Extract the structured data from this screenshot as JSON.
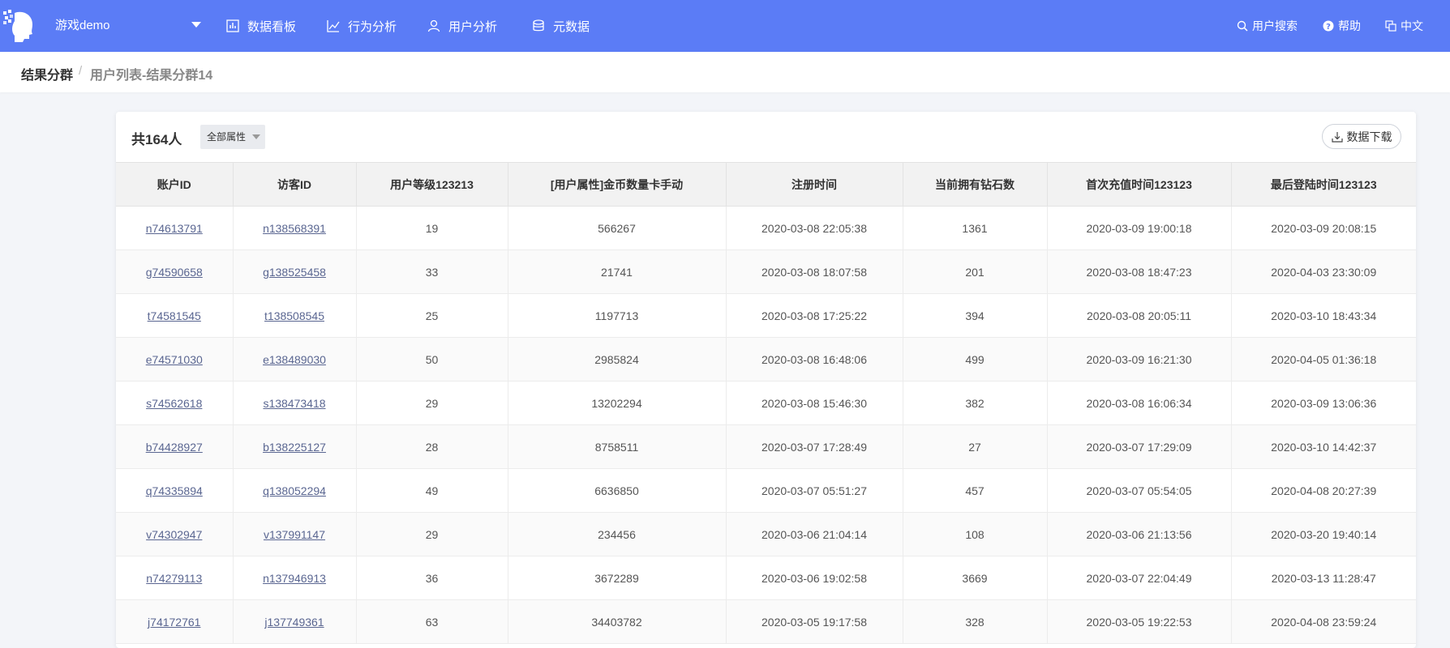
{
  "header": {
    "app_name": "游戏demo",
    "nav": [
      {
        "label": "数据看板",
        "icon": "bar-chart-icon"
      },
      {
        "label": "行为分析",
        "icon": "line-chart-icon"
      },
      {
        "label": "用户分析",
        "icon": "user-icon"
      },
      {
        "label": "元数据",
        "icon": "database-icon"
      }
    ],
    "right": [
      {
        "label": "用户搜索",
        "icon": "search-icon"
      },
      {
        "label": "帮助",
        "icon": "help-icon"
      },
      {
        "label": "中文",
        "icon": "language-icon"
      }
    ],
    "bg_color": "#5b7cf6"
  },
  "breadcrumb": {
    "root": "结果分群",
    "separator": "/",
    "current": "用户列表-结果分群14"
  },
  "card": {
    "total": "共164人",
    "filter": "全部属性",
    "download": "数据下载"
  },
  "table": {
    "columns": [
      "账户ID",
      "访客ID",
      "用户等级123213",
      "[用户属性]金币数量卡手动",
      "注册时间",
      "当前拥有钻石数",
      "首次充值时间123123",
      "最后登陆时间123123"
    ],
    "rows": [
      [
        "n74613791",
        "n138568391",
        "19",
        "566267",
        "2020-03-08 22:05:38",
        "1361",
        "2020-03-09 19:00:18",
        "2020-03-09 20:08:15"
      ],
      [
        "g74590658",
        "g138525458",
        "33",
        "21741",
        "2020-03-08 18:07:58",
        "201",
        "2020-03-08 18:47:23",
        "2020-04-03 23:30:09"
      ],
      [
        "t74581545",
        "t138508545",
        "25",
        "1197713",
        "2020-03-08 17:25:22",
        "394",
        "2020-03-08 20:05:11",
        "2020-03-10 18:43:34"
      ],
      [
        "e74571030",
        "e138489030",
        "50",
        "2985824",
        "2020-03-08 16:48:06",
        "499",
        "2020-03-09 16:21:30",
        "2020-04-05 01:36:18"
      ],
      [
        "s74562618",
        "s138473418",
        "29",
        "13202294",
        "2020-03-08 15:46:30",
        "382",
        "2020-03-08 16:06:34",
        "2020-03-09 13:06:36"
      ],
      [
        "b74428927",
        "b138225127",
        "28",
        "8758511",
        "2020-03-07 17:28:49",
        "27",
        "2020-03-07 17:29:09",
        "2020-03-10 14:42:37"
      ],
      [
        "q74335894",
        "q138052294",
        "49",
        "6636850",
        "2020-03-07 05:51:27",
        "457",
        "2020-03-07 05:54:05",
        "2020-04-08 20:27:39"
      ],
      [
        "v74302947",
        "v137991147",
        "29",
        "234456",
        "2020-03-06 21:04:14",
        "108",
        "2020-03-06 21:13:56",
        "2020-03-20 19:40:14"
      ],
      [
        "n74279113",
        "n137946913",
        "36",
        "3672289",
        "2020-03-06 19:02:58",
        "3669",
        "2020-03-07 22:04:49",
        "2020-03-13 11:28:47"
      ],
      [
        "j74172761",
        "j137749361",
        "63",
        "34403782",
        "2020-03-05 19:17:58",
        "328",
        "2020-03-05 19:22:53",
        "2020-04-08 23:59:24"
      ]
    ]
  }
}
